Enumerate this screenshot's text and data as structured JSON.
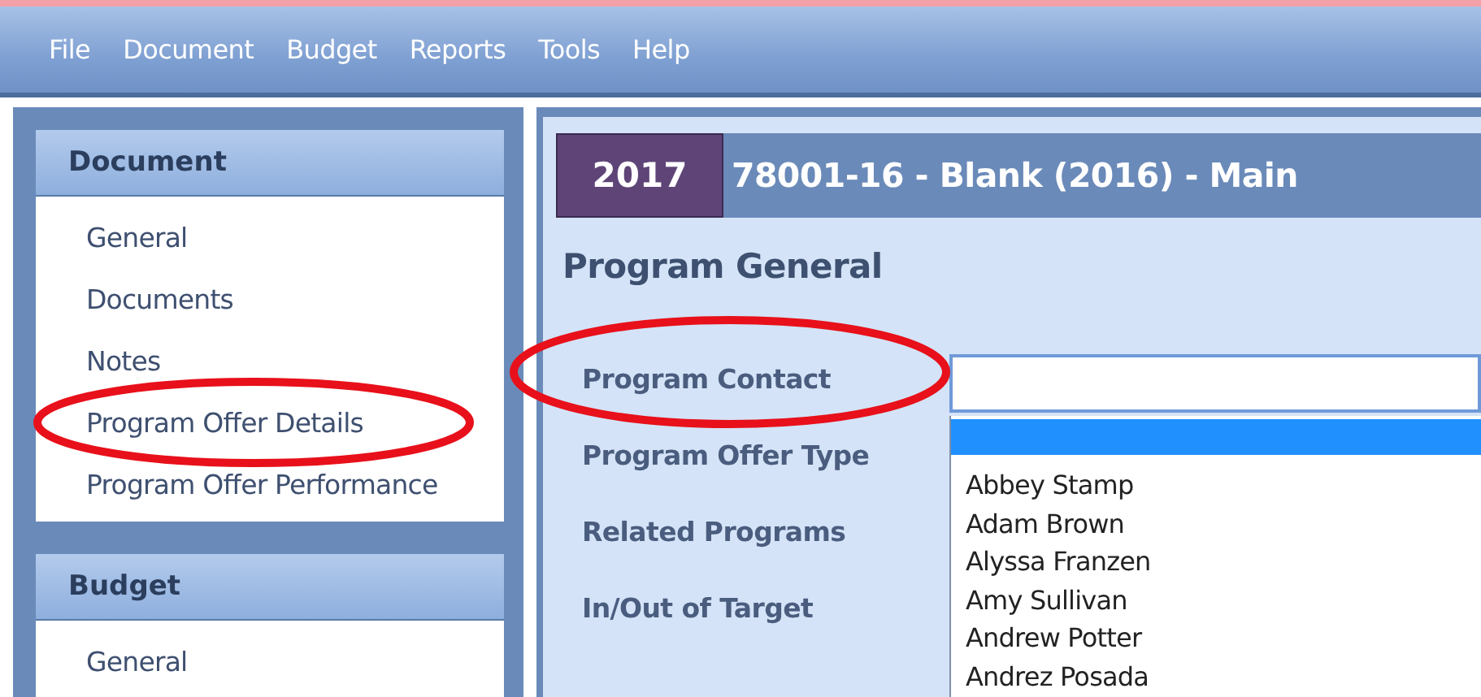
{
  "menu": [
    "File",
    "Document",
    "Budget",
    "Reports",
    "Tools",
    "Help"
  ],
  "sidebar": [
    {
      "title": "Document",
      "items": [
        {
          "label": "General",
          "selected": false
        },
        {
          "label": "Documents",
          "selected": false
        },
        {
          "label": "Notes",
          "selected": false
        },
        {
          "label": "Program Offer Details",
          "selected": false
        },
        {
          "label": "Program Offer Performance",
          "selected": false
        }
      ]
    },
    {
      "title": "Budget",
      "items": [
        {
          "label": "General",
          "selected": false
        }
      ]
    }
  ],
  "header": {
    "year": "2017",
    "title": "78001-16 - Blank (2016) - Main"
  },
  "section_title": "Program General",
  "fields": [
    "Program Contact",
    "Program Offer Type",
    "Related Programs",
    "In/Out of Target"
  ],
  "dropdown": {
    "blank_row_selected": true,
    "items": [
      {
        "label": "Abbey Stamp",
        "selected": false
      },
      {
        "label": "Adam Brown",
        "selected": false
      },
      {
        "label": "Alyssa Franzen",
        "selected": false
      },
      {
        "label": "Amy Sullivan",
        "selected": false
      },
      {
        "label": "Andrew Potter",
        "selected": false
      },
      {
        "label": "Andrez Posada",
        "selected": false
      }
    ]
  }
}
